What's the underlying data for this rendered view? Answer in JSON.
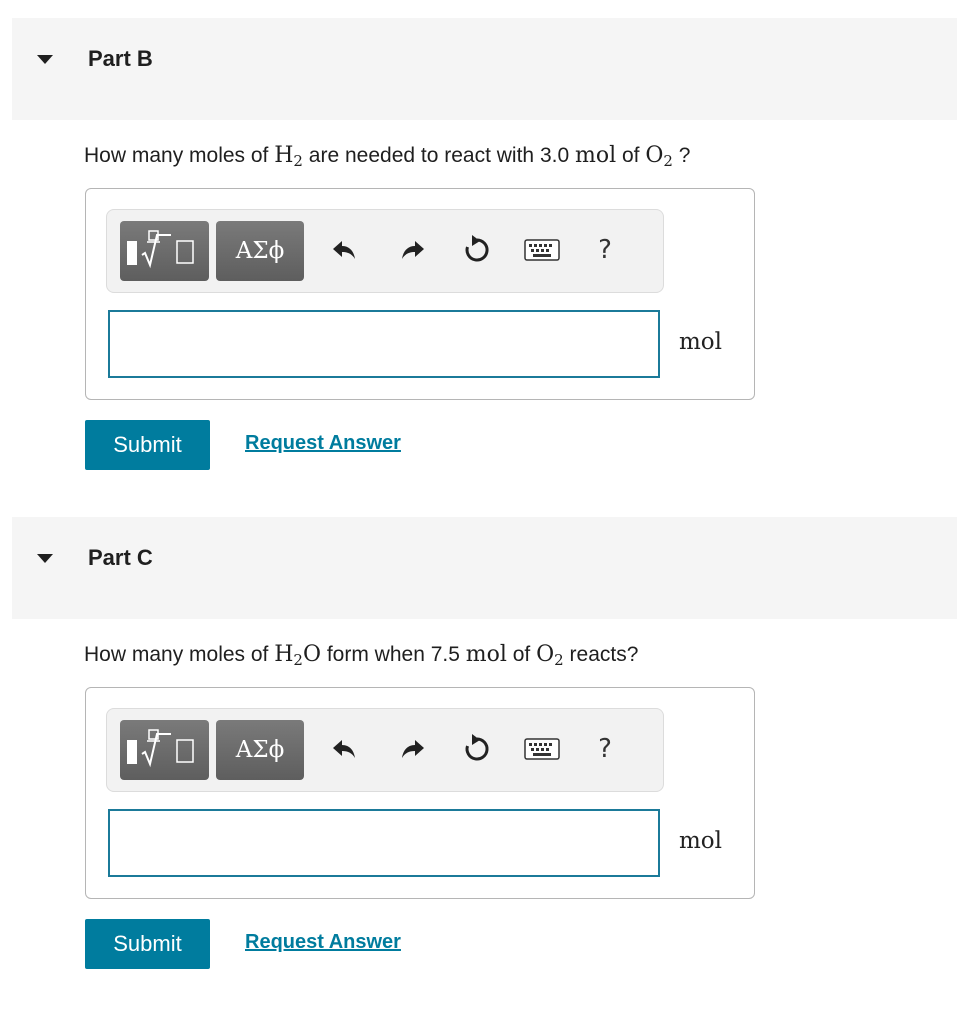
{
  "parts": [
    {
      "title": "Part B",
      "question": {
        "pre": "How many moles of ",
        "species1_base": "H",
        "species1_sub": "2",
        "species1_tail": "",
        "mid": " are needed to react with 3.0 ",
        "unit_inline": "mol",
        "of_text": " of ",
        "species2_base": "O",
        "species2_sub": "2",
        "post": " ?"
      },
      "toolbar": {
        "templates_label": "templates",
        "greek_label": "ΑΣϕ",
        "help_label": "?"
      },
      "input_value": "",
      "unit": "mol",
      "submit_label": "Submit",
      "request_label": "Request Answer"
    },
    {
      "title": "Part C",
      "question": {
        "pre": "How many moles of ",
        "species1_base": "H",
        "species1_sub": "2",
        "species1_tail": "O",
        "mid": " form when 7.5 ",
        "unit_inline": "mol",
        "of_text": " of ",
        "species2_base": "O",
        "species2_sub": "2",
        "post": " reacts?"
      },
      "toolbar": {
        "templates_label": "templates",
        "greek_label": "ΑΣϕ",
        "help_label": "?"
      },
      "input_value": "",
      "unit": "mol",
      "submit_label": "Submit",
      "request_label": "Request Answer"
    }
  ],
  "icons": {
    "caret": "caret-down-icon",
    "templates": "fraction-root-template-icon",
    "undo": "undo-icon",
    "redo": "redo-icon",
    "reset": "reset-icon",
    "keyboard": "keyboard-icon",
    "help": "help-icon"
  },
  "colors": {
    "accent": "#007c9e",
    "input_border": "#1b7a99",
    "header_bg": "#f5f5f5",
    "toolbar_button": "#6b6b6b"
  }
}
